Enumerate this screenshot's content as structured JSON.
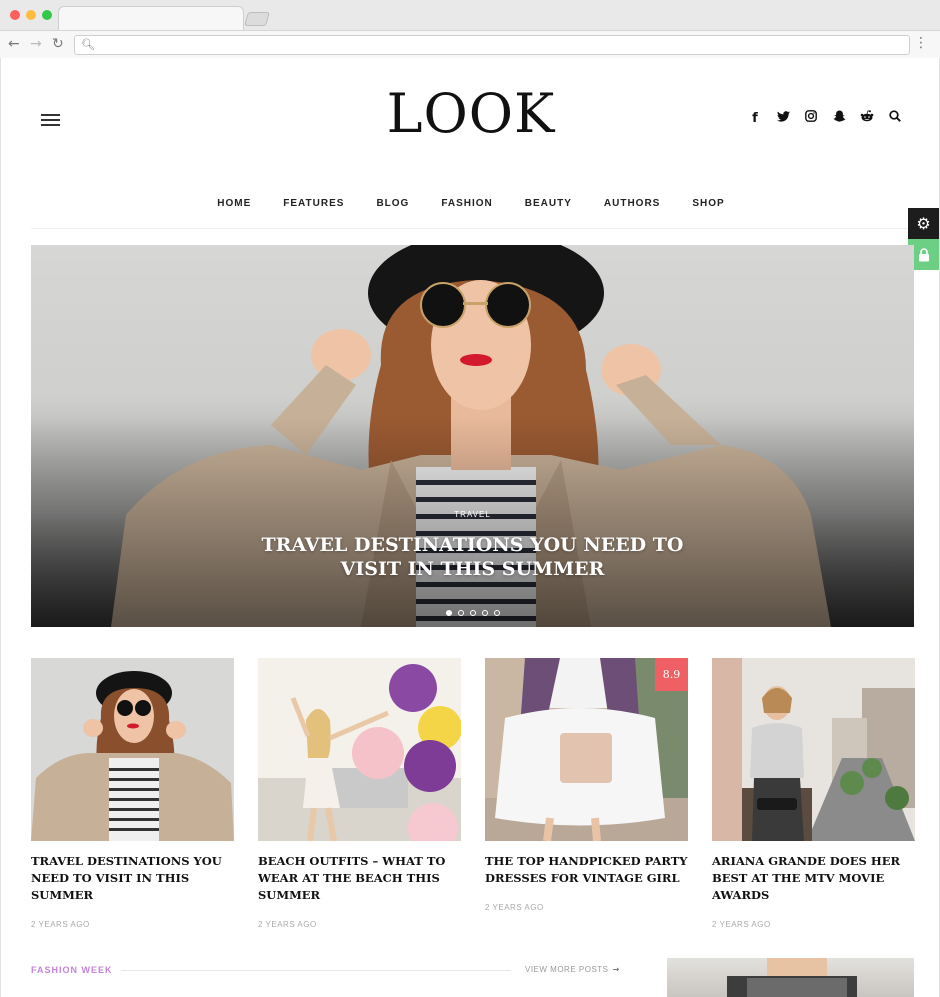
{
  "browser": {
    "dot_colors": [
      "#fc605c",
      "#fdbc40",
      "#34c84a"
    ],
    "back_icon": "back-arrow-icon",
    "forward_icon": "forward-arrow-icon",
    "reload_icon": "reload-icon",
    "search_icon": "search-icon",
    "menu_icon": "vertical-dots-icon",
    "address_value": ""
  },
  "header": {
    "logo": "LOOK",
    "menu_icon": "hamburger-icon",
    "social": [
      {
        "name": "facebook-icon",
        "glyph": "f"
      },
      {
        "name": "twitter-icon",
        "glyph": "t"
      },
      {
        "name": "instagram-icon",
        "glyph": "◎"
      },
      {
        "name": "snapchat-icon",
        "glyph": "☗"
      },
      {
        "name": "reddit-icon",
        "glyph": "☻"
      },
      {
        "name": "search-icon",
        "glyph": "⌕"
      }
    ]
  },
  "nav": {
    "items": [
      "HOME",
      "FEATURES",
      "BLOG",
      "FASHION",
      "BEAUTY",
      "AUTHORS",
      "SHOP"
    ]
  },
  "side_tools": {
    "gear_glyph": "⚙",
    "lock_glyph": "🔒",
    "colors": {
      "gear": "#1d1d1d",
      "lock": "#6ccf83"
    }
  },
  "hero": {
    "category": "TRAVEL",
    "title": "TRAVEL DESTINATIONS YOU NEED TO VISIT IN THIS SUMMER",
    "slide_count": 5,
    "active_slide": 1
  },
  "cards": [
    {
      "title": "TRAVEL DESTINATIONS YOU NEED TO VISIT IN THIS SUMMER",
      "meta": "2 YEARS AGO",
      "score": ""
    },
    {
      "title": "BEACH OUTFITS – WHAT TO WEAR AT THE BEACH THIS SUMMER",
      "meta": "2 YEARS AGO",
      "score": ""
    },
    {
      "title": "THE TOP HANDPICKED PARTY DRESSES FOR VINTAGE GIRL",
      "meta": "2 YEARS AGO",
      "score": "8.9"
    },
    {
      "title": "ARIANA GRANDE DOES HER BEST AT THE MTV MOVIE AWARDS",
      "meta": "2 YEARS AGO",
      "score": ""
    }
  ],
  "section": {
    "label": "FASHION WEEK",
    "view_more": "VIEW MORE POSTS",
    "arrow": "→",
    "accent": "#c285d8"
  }
}
